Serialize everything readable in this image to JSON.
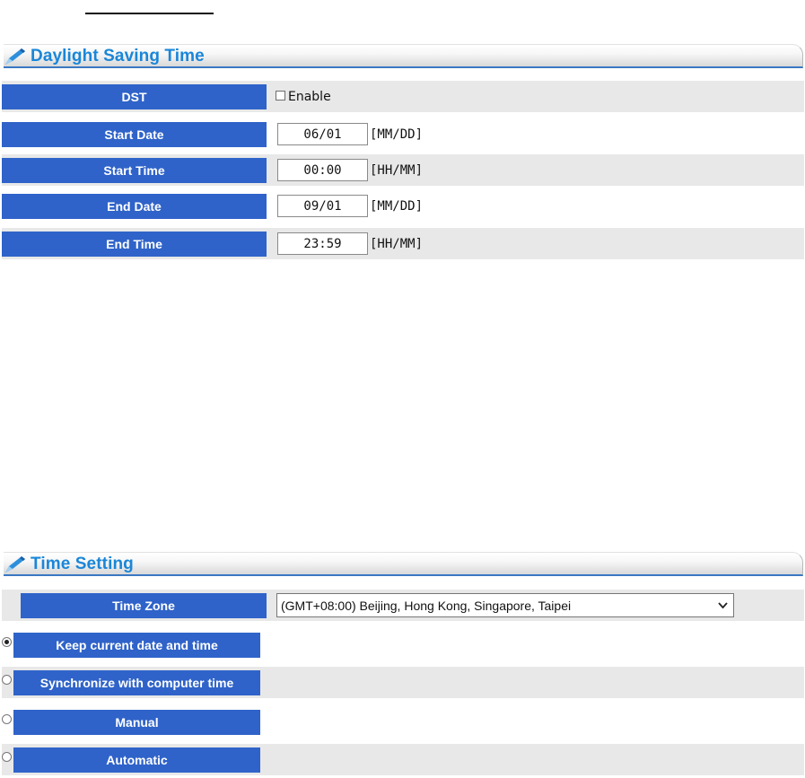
{
  "dst_section": {
    "title": "Daylight Saving Time",
    "dst_label": "DST",
    "enable_label": "Enable",
    "enabled": false,
    "start_date_label": "Start Date",
    "start_date_value": "06/01",
    "start_date_unit": "[MM/DD]",
    "start_time_label": "Start Time",
    "start_time_value": "00:00",
    "start_time_unit": "[HH/MM]",
    "end_date_label": "End Date",
    "end_date_value": "09/01",
    "end_date_unit": "[MM/DD]",
    "end_time_label": "End Time",
    "end_time_value": "23:59",
    "end_time_unit": "[HH/MM]"
  },
  "time_section": {
    "title": "Time Setting",
    "time_zone_label": "Time Zone",
    "time_zone_value": "(GMT+08:00) Beijing, Hong Kong, Singapore, Taipei",
    "options": [
      {
        "label": "Keep current date and time",
        "selected": true
      },
      {
        "label": "Synchronize with computer time",
        "selected": false
      },
      {
        "label": "Manual",
        "selected": false
      },
      {
        "label": "Automatic",
        "selected": false
      }
    ]
  },
  "colors": {
    "label_bg": "#2f63c9",
    "title_text": "#1a86d8",
    "row_gray": "#e8e8e8"
  },
  "icons": {
    "section_header": "pen-icon",
    "dropdown": "chevron-down-icon"
  }
}
